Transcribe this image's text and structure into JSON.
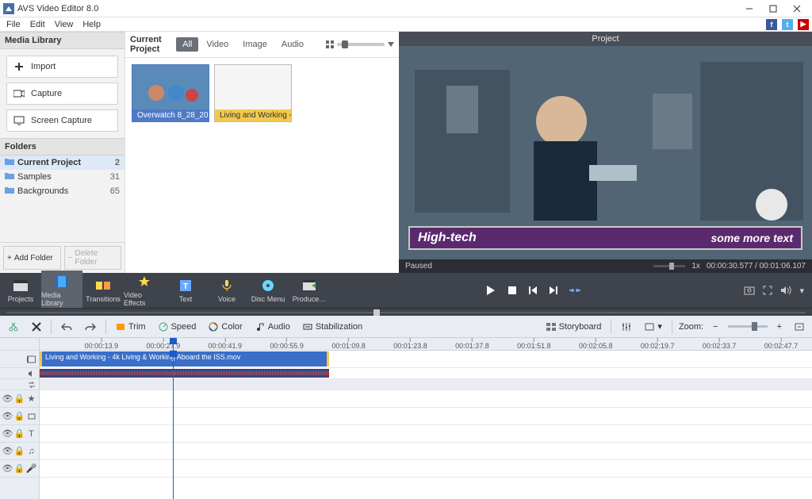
{
  "app": {
    "title": "AVS Video Editor 8.0"
  },
  "menubar": [
    "File",
    "Edit",
    "View",
    "Help"
  ],
  "socials": [
    "facebook",
    "twitter",
    "youtube"
  ],
  "media_library": {
    "title": "Media Library",
    "buttons": [
      {
        "id": "import",
        "label": "Import",
        "icon": "plus"
      },
      {
        "id": "capture",
        "label": "Capture",
        "icon": "camera"
      },
      {
        "id": "screen-capture",
        "label": "Screen Capture",
        "icon": "monitor"
      }
    ]
  },
  "folders": {
    "title": "Folders",
    "items": [
      {
        "name": "Current Project",
        "count": 2,
        "selected": true
      },
      {
        "name": "Samples",
        "count": 31,
        "selected": false
      },
      {
        "name": "Backgrounds",
        "count": 65,
        "selected": false
      }
    ],
    "add_label": "Add Folder",
    "del_label": "Delete Folder"
  },
  "current_project": {
    "label": "Current Project",
    "tabs": [
      "All",
      "Video",
      "Image",
      "Audio"
    ],
    "active_tab": "All",
    "clips": [
      {
        "name": "Overwatch 8_28_20…",
        "selected": true
      },
      {
        "name": "Living and Working - …",
        "selected": false
      }
    ]
  },
  "preview": {
    "title": "Project",
    "status": "Paused",
    "speed": "1x",
    "time_current": "00:00:30.577",
    "time_total": "00:01:06.107",
    "caption_left": "High-tech",
    "caption_right": "some more text"
  },
  "dark_tabs": [
    {
      "id": "projects",
      "label": "Projects",
      "color": "#ffffff"
    },
    {
      "id": "media-library",
      "label": "Media Library",
      "color": "#4aa8ff",
      "selected": true
    },
    {
      "id": "transitions",
      "label": "Transitions",
      "color": "#ffd94a"
    },
    {
      "id": "video-effects",
      "label": "Video Effects",
      "color": "#ffd94a"
    },
    {
      "id": "text",
      "label": "Text",
      "color": "#6aa8ff"
    },
    {
      "id": "voice",
      "label": "Voice",
      "color": "#ffd94a"
    },
    {
      "id": "disc-menu",
      "label": "Disc Menu",
      "color": "#6ad6ff"
    },
    {
      "id": "produce",
      "label": "Produce…",
      "color": "#ffffff"
    }
  ],
  "timeline_tools": {
    "trim": "Trim",
    "speed": "Speed",
    "color": "Color",
    "audio": "Audio",
    "stab": "Stabilization",
    "storyboard": "Storyboard",
    "zoom": "Zoom:"
  },
  "ruler": [
    "00:00:13.9",
    "00:00:27.9",
    "00:00:41.9",
    "00:00:55.9",
    "00:01:09.8",
    "00:01:23.8",
    "00:01:37.8",
    "00:01:51.8",
    "00:02:05.8",
    "00:02:19.7",
    "00:02:33.7",
    "00:02:47.7"
  ],
  "clip_label": "Living and Working - 4k Living & Working Aboard the ISS.mov",
  "playhead_pct": 17.2,
  "clip_end_pct": 37.5
}
